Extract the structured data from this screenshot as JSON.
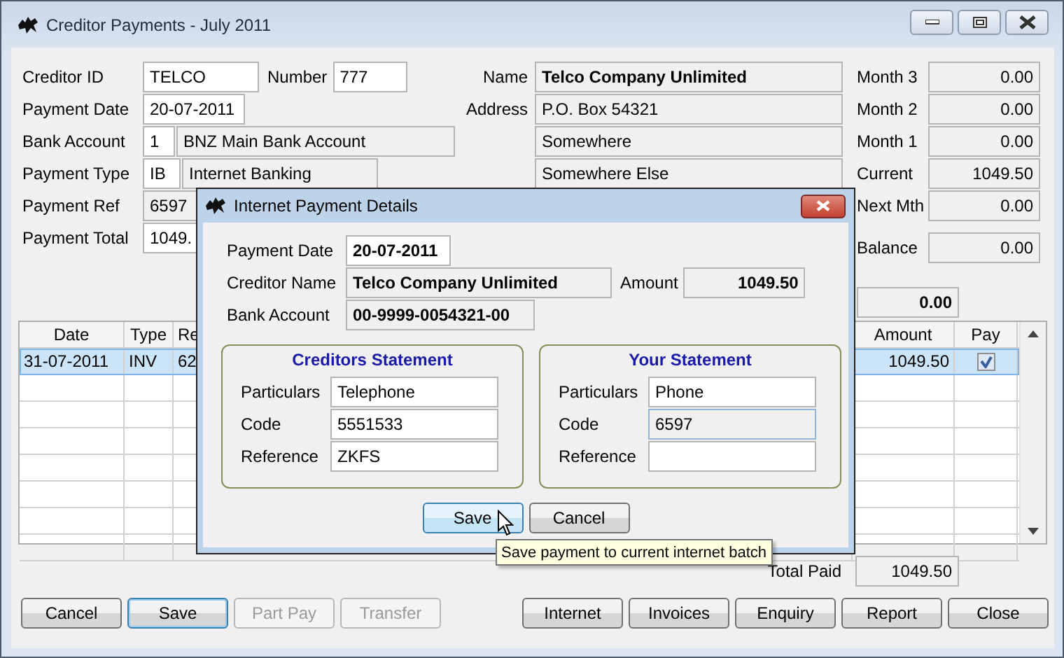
{
  "window": {
    "title": "Creditor Payments - July 2011"
  },
  "details": [
    {
      "label": "Creditor ID",
      "fields": [
        {
          "value": "TELCO",
          "readonly": false
        }
      ]
    },
    {
      "label": "Payment Date",
      "fields": [
        {
          "value": "20-07-2011",
          "readonly": false
        }
      ]
    },
    {
      "label": "Bank Account",
      "fields": [
        {
          "value": "1",
          "readonly": false
        },
        {
          "value": "BNZ Main Bank Account",
          "readonly": true
        }
      ]
    },
    {
      "label": "Payment Type",
      "fields": [
        {
          "value": "IB",
          "readonly": false
        },
        {
          "value": "Internet Banking",
          "readonly": true
        }
      ]
    },
    {
      "label": "Payment Ref",
      "fields": [
        {
          "value": "6597",
          "readonly": true
        }
      ]
    },
    {
      "label": "Payment Total",
      "fields": [
        {
          "value": "1049.",
          "readonly": false
        }
      ]
    }
  ],
  "number": {
    "label": "Number",
    "value": "777"
  },
  "creditor": {
    "name_label": "Name",
    "name": "Telco Company Unlimited",
    "address_label": "Address",
    "address_lines": [
      "P.O. Box 54321",
      "Somewhere",
      "Somewhere Else"
    ]
  },
  "aging": [
    {
      "label": "Month 3",
      "value": "0.00"
    },
    {
      "label": "Month 2",
      "value": "0.00"
    },
    {
      "label": "Month 1",
      "value": "0.00"
    },
    {
      "label": "Current",
      "value": "1049.50"
    },
    {
      "label": "Next Mth",
      "value": "0.00"
    }
  ],
  "balance": {
    "label": "Balance",
    "value": "0.00"
  },
  "unallocated": "0.00",
  "table": {
    "columns": [
      "Date",
      "Type",
      "Re",
      "Amount",
      "Pay"
    ],
    "rows": [
      {
        "date": "31-07-2011",
        "type": "INV",
        "ref": "62",
        "amount": "1049.50",
        "pay": true,
        "selected": true
      }
    ]
  },
  "total_paid": {
    "label": "Total Paid",
    "value": "1049.50"
  },
  "left_buttons": [
    {
      "label": "Cancel",
      "disabled": false,
      "focused": false
    },
    {
      "label": "Save",
      "disabled": false,
      "focused": true
    },
    {
      "label": "Part Pay",
      "disabled": true,
      "focused": false
    },
    {
      "label": "Transfer",
      "disabled": true,
      "focused": false
    }
  ],
  "right_buttons": [
    {
      "label": "Internet",
      "disabled": false,
      "focused": false
    },
    {
      "label": "Invoices",
      "disabled": false,
      "focused": false
    },
    {
      "label": "Enquiry",
      "disabled": false,
      "focused": false
    },
    {
      "label": "Report",
      "disabled": false,
      "focused": false
    },
    {
      "label": "Close",
      "disabled": false,
      "focused": false
    }
  ],
  "dialog": {
    "title": "Internet Payment Details",
    "payment_date": {
      "label": "Payment Date",
      "value": "20-07-2011"
    },
    "creditor_name": {
      "label": "Creditor Name",
      "value": "Telco Company Unlimited"
    },
    "amount": {
      "label": "Amount",
      "value": "1049.50"
    },
    "bank_account": {
      "label": "Bank Account",
      "value": "00-9999-0054321-00"
    },
    "groups": [
      {
        "title": "Creditors Statement",
        "fields": [
          {
            "label": "Particulars",
            "value": "Telephone",
            "focused": false
          },
          {
            "label": "Code",
            "value": "5551533",
            "focused": false
          },
          {
            "label": "Reference",
            "value": "ZKFS",
            "focused": false
          }
        ]
      },
      {
        "title": "Your Statement",
        "fields": [
          {
            "label": "Particulars",
            "value": "Phone",
            "focused": false
          },
          {
            "label": "Code",
            "value": "6597",
            "focused": true
          },
          {
            "label": "Reference",
            "focused": false
          }
        ]
      }
    ],
    "buttons": [
      {
        "label": "Save",
        "hovered": true
      },
      {
        "label": "Cancel",
        "hovered": false
      }
    ],
    "tooltip": "Save payment to current internet batch"
  }
}
